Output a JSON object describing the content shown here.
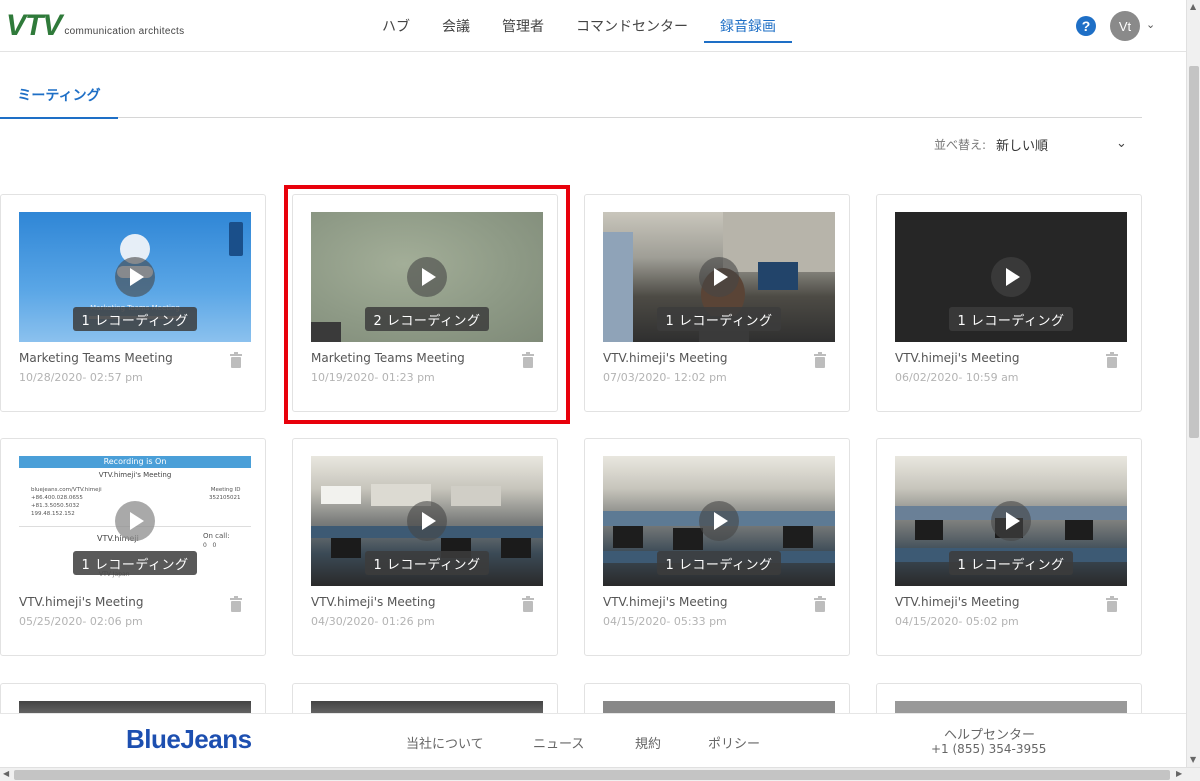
{
  "header": {
    "logo_mark": "VTV",
    "logo_text": "communication architects",
    "nav": [
      "ハブ",
      "会議",
      "管理者",
      "コマンドセンター",
      "録音録画"
    ],
    "active_nav": "録音録画",
    "help": "?",
    "avatar": "Vt",
    "colors": {
      "accent": "#1e6fc6",
      "logo_green": "#2f7a3a",
      "highlight": "#e8000b"
    }
  },
  "tabs": [
    {
      "label": "ミーティング",
      "active": true
    }
  ],
  "sort": {
    "label": "並べ替え:",
    "value": "新しい順"
  },
  "cards": [
    {
      "title": "Marketing Teams Meeting",
      "date": "10/28/2020- 02:57 pm",
      "recordings": "1 レコーディング",
      "thumb": "blue-screen"
    },
    {
      "title": "Marketing Teams Meeting",
      "date": "10/19/2020- 01:23 pm",
      "recordings": "2 レコーディング",
      "thumb": "green-blur",
      "highlighted": true
    },
    {
      "title": "VTV.himeji's Meeting",
      "date": "07/03/2020- 12:02 pm",
      "recordings": "1 レコーディング",
      "thumb": "office-person"
    },
    {
      "title": "VTV.himeji's Meeting",
      "date": "06/02/2020- 10:59 am",
      "recordings": "1 レコーディング",
      "thumb": "dark"
    },
    {
      "title": "VTV.himeji's Meeting",
      "date": "05/25/2020- 02:06 pm",
      "recordings": "1 レコーディング",
      "thumb": "recording-screen"
    },
    {
      "title": "VTV.himeji's Meeting",
      "date": "04/30/2020- 01:26 pm",
      "recordings": "1 レコーディング",
      "thumb": "office"
    },
    {
      "title": "VTV.himeji's Meeting",
      "date": "04/15/2020- 05:33 pm",
      "recordings": "1 レコーディング",
      "thumb": "office"
    },
    {
      "title": "VTV.himeji's Meeting",
      "date": "04/15/2020- 05:02 pm",
      "recordings": "1 レコーディング",
      "thumb": "office"
    }
  ],
  "thumbnail_text": {
    "blue_title": "Marketing Teams Meeting",
    "rec_banner": "Recording is On",
    "rec_title": "VTV.himeji's Meeting",
    "rec_url": "bluejeans.com/VTV.himeji",
    "meeting_id_label": "Meeting ID",
    "meeting_id": "352105021",
    "phone1": "+86.400.028.0655",
    "phone2": "+81.3.5050.5032",
    "ip": "199.48.152.152",
    "host": "VTV.himeji",
    "host_sub": "VTV Japan",
    "on_call": "On call:",
    "on_call_counts": "0   0"
  },
  "footer": {
    "brand": "BlueJeans",
    "links": [
      "当社について",
      "ニュース",
      "規約",
      "ポリシー"
    ],
    "help_center": "ヘルプセンター",
    "phone": "+1 (855) 354-3955"
  }
}
